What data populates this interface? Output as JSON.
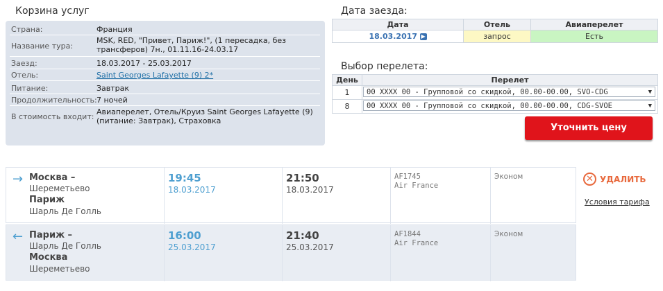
{
  "basket": {
    "title": "Корзина услуг",
    "rows": [
      {
        "label": "Страна:",
        "value": "Франция"
      },
      {
        "label": "Название тура:",
        "value": "MSK, RED, \"Привет, Париж!\", (1 пересадка, без трансферов) 7н., 01.11.16-24.03.17"
      },
      {
        "label": "Заезд:",
        "value": "18.03.2017 - 25.03.2017"
      },
      {
        "label": "Отель:",
        "value": "Saint Georges Lafayette (9) 2*"
      },
      {
        "label": "Питание:",
        "value": "Завтрак"
      },
      {
        "label": "Продолжительность:",
        "value": "7 ночей"
      },
      {
        "label": "В стоимость входит:",
        "value": "Авиаперелет, Отель/Круиз Saint Georges Lafayette (9) (питание: Завтрак), Страховка"
      }
    ]
  },
  "checkin": {
    "title": "Дата заезда:",
    "headers": {
      "date": "Дата",
      "hotel": "Отель",
      "flight": "Авиаперелет"
    },
    "row": {
      "date": "18.03.2017",
      "hotel": "запрос",
      "flight": "Есть"
    },
    "colors": {
      "hotel_bg": "#fdf8c4",
      "flight_bg": "#c9f5c2",
      "date_color": "#3a72b2"
    }
  },
  "flight_choice": {
    "title": "Выбор перелета:",
    "headers": {
      "day": "День",
      "flight": "Перелет"
    },
    "rows": [
      {
        "day": "1",
        "value": "00 XXXX 00 - Групповой со скидкой, 00.00-00.00, SVO-CDG"
      },
      {
        "day": "8",
        "value": "00 XXXX 00 - Групповой со скидкой, 00.00-00.00, CDG-SVOE"
      }
    ]
  },
  "price_button": "Уточнить цену",
  "flights": [
    {
      "from_city": "Москва –",
      "from_airport": "Шереметьево",
      "to_city": "Париж",
      "to_airport": "Шарль Де Голль",
      "dep_time": "19:45",
      "dep_date": "18.03.2017",
      "arr_time": "21:50",
      "arr_date": "18.03.2017",
      "code": "AF1745",
      "airline": "Air France",
      "class": "Эконом"
    },
    {
      "from_city": "Париж –",
      "from_airport": "Шарль Де Голль",
      "to_city": "Москва",
      "to_airport": "Шереметьево",
      "dep_time": "16:00",
      "dep_date": "25.03.2017",
      "arr_time": "21:40",
      "arr_date": "25.03.2017",
      "code": "AF1844",
      "airline": "Air France",
      "class": "Эконом"
    }
  ],
  "actions": {
    "delete": "УДАЛИТЬ",
    "tariff": "Условия тарифа"
  },
  "colors": {
    "accent": "#4e9fd0",
    "danger": "#e0141b",
    "delete": "#e8693d",
    "panel": "#dde3ec"
  }
}
